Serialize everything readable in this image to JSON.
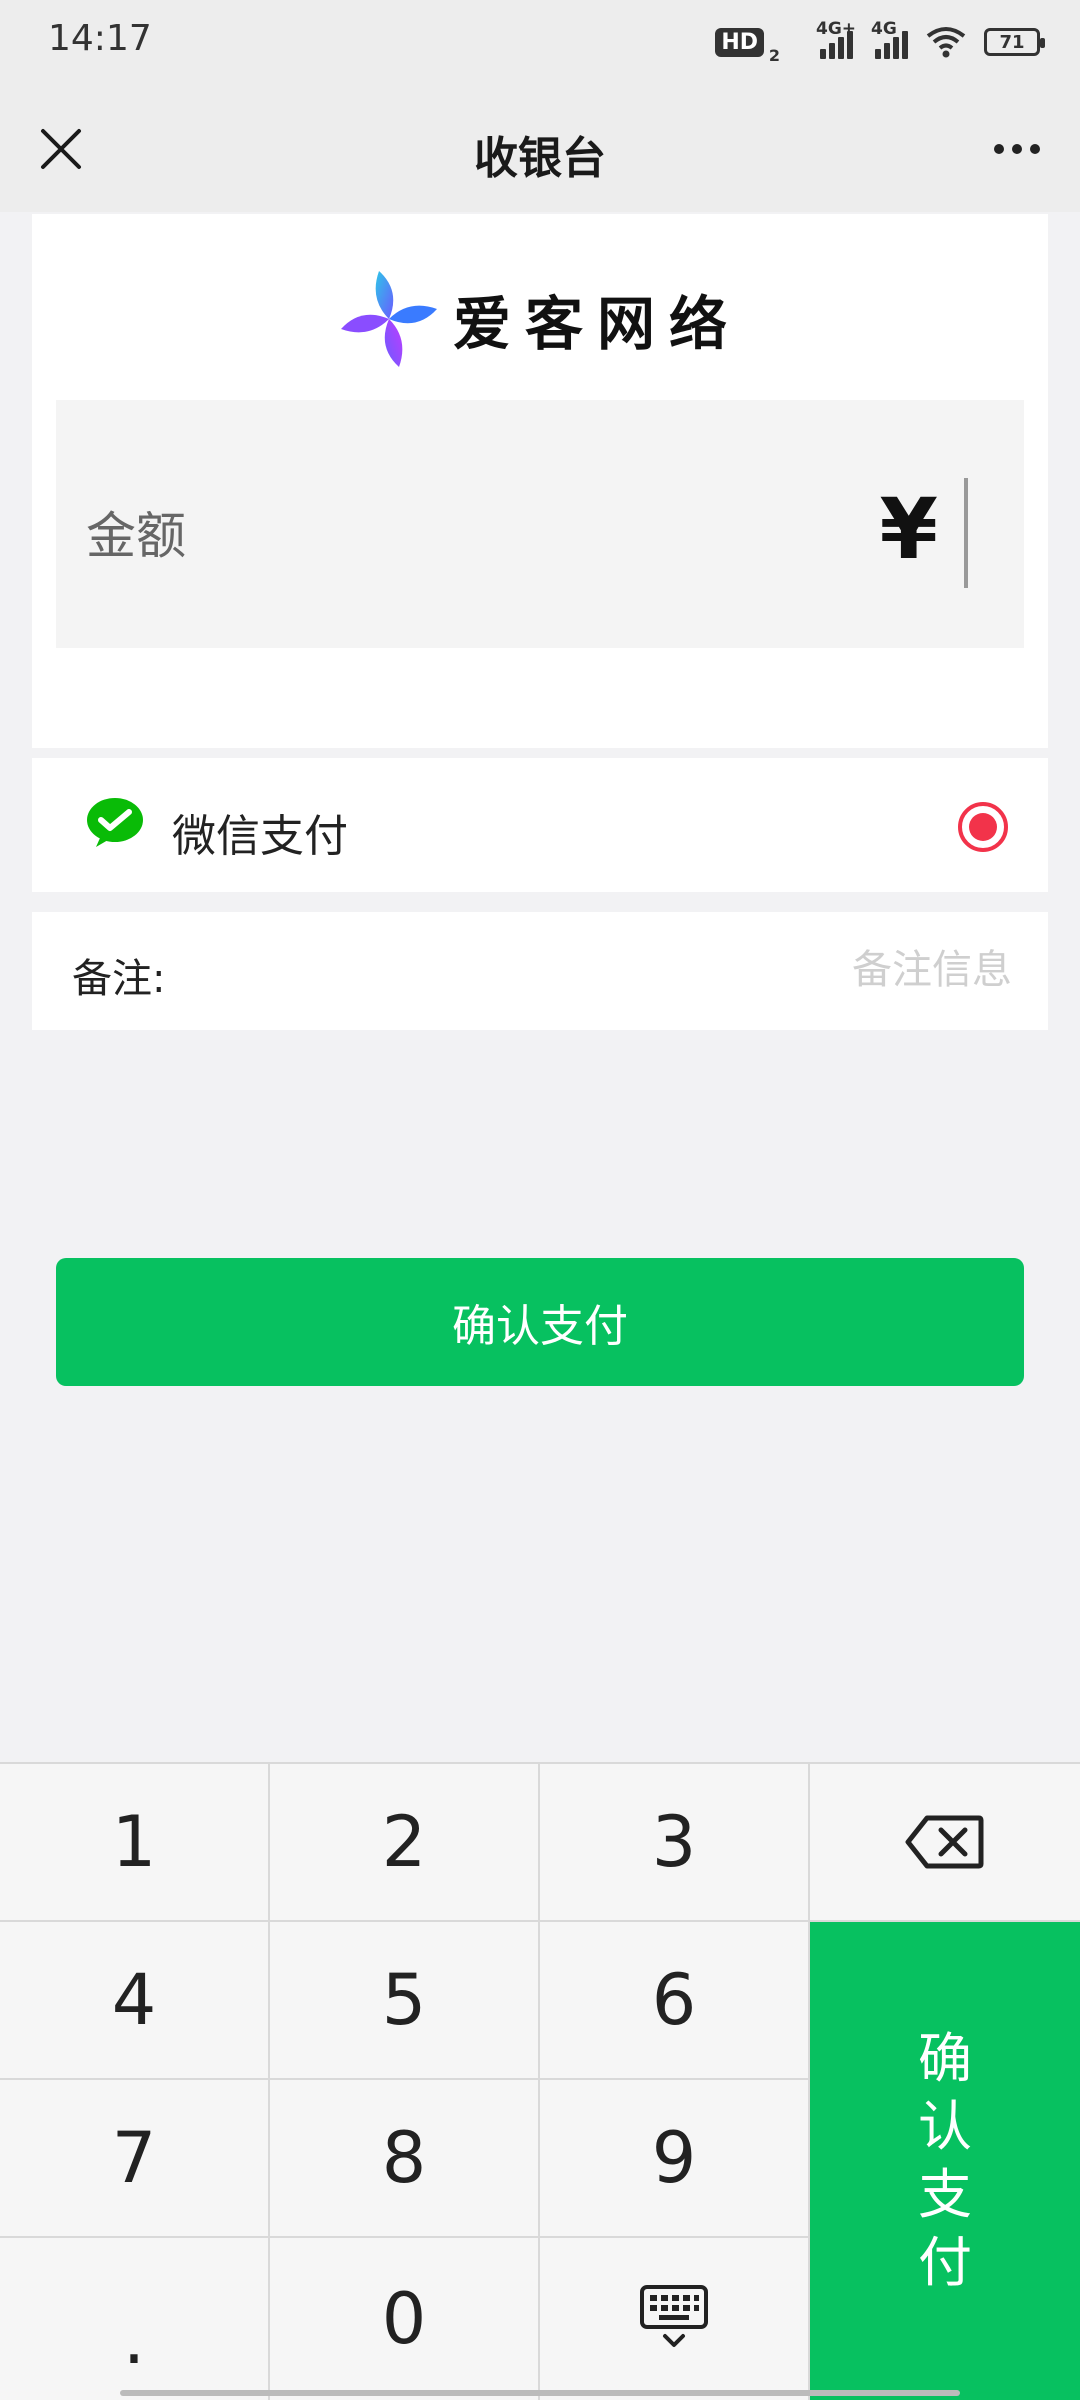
{
  "status_bar": {
    "time": "14:17",
    "hd_label": "HD",
    "hd_sub": "2",
    "signal1_tag": "4G+",
    "signal2_tag": "4G",
    "battery": "71"
  },
  "nav": {
    "title": "收银台",
    "close_icon": "close-icon",
    "more_icon": "more-icon"
  },
  "brand": {
    "name": "爱客网络",
    "logo_colors": [
      "#2ec5e8",
      "#6a5cff",
      "#c03cff"
    ]
  },
  "amount": {
    "label": "金额",
    "currency_symbol": "¥"
  },
  "payment": {
    "method_label": "微信支付",
    "icon": "wechat-icon",
    "selected": true,
    "accent": "#f2334a"
  },
  "remark": {
    "label": "备注:",
    "placeholder": "备注信息"
  },
  "confirm_button": {
    "label": "确认支付",
    "color": "#07c160"
  },
  "keypad": {
    "keys": [
      "1",
      "2",
      "3",
      "4",
      "5",
      "6",
      "7",
      "8",
      "9",
      ".",
      "0"
    ],
    "backspace_icon": "backspace-icon",
    "hide_keyboard_icon": "keyboard-hide-icon",
    "pay_key_chars": [
      "确",
      "认",
      "支",
      "付"
    ]
  }
}
